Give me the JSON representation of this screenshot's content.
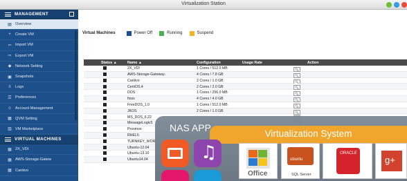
{
  "window": {
    "title": "Virtualization Station",
    "buttons": [
      "#6cbf3a",
      "#2f9ee3",
      "#e84a3c"
    ]
  },
  "sidebar": {
    "management_header": "MANAGEMENT",
    "items": [
      {
        "label": "Overview",
        "icon": "overview-icon",
        "glyph": "▤",
        "active": true
      },
      {
        "label": "Create VM",
        "icon": "plus-icon",
        "glyph": "+"
      },
      {
        "label": "Import VM",
        "icon": "import-icon",
        "glyph": "⇦"
      },
      {
        "label": "Export VM",
        "icon": "export-icon",
        "glyph": "⇨"
      },
      {
        "label": "Network Setting",
        "icon": "network-icon",
        "glyph": "◆"
      },
      {
        "label": "Snapshots",
        "icon": "snapshot-icon",
        "glyph": "▣"
      },
      {
        "label": "Logs",
        "icon": "logs-icon",
        "glyph": "≡"
      },
      {
        "label": "Preferences",
        "icon": "preferences-icon",
        "glyph": "☰"
      },
      {
        "label": "Account Management",
        "icon": "account-icon",
        "glyph": "☺"
      },
      {
        "label": "QVM Setting",
        "icon": "qvm-icon",
        "glyph": "▦"
      },
      {
        "label": "VM Marketplace",
        "icon": "marketplace-icon",
        "glyph": "▥"
      }
    ],
    "vm_header": "VIRTUAL MACHINES",
    "vm_items": [
      {
        "label": "2X_VDI"
      },
      {
        "label": "AWS-Storage-Gatew"
      },
      {
        "label": "Cantivo"
      }
    ]
  },
  "toolbar": {
    "title": "Virtual Machines",
    "legend": [
      {
        "label": "Power Off",
        "color": "#1d4f8a"
      },
      {
        "label": "Running",
        "color": "#4caf50"
      },
      {
        "label": "Suspend",
        "color": "#f0b428"
      }
    ]
  },
  "table": {
    "headers": {
      "status": "Status ▲",
      "name": "Name ▲",
      "configuration": "Configuration",
      "usage": "Usage Rate",
      "action": "Action"
    },
    "action_buttons": [
      "▶",
      "⏸",
      "◯",
      "■",
      "⚙",
      "🔍"
    ],
    "rows": [
      {
        "name": "2X_VDI",
        "config": "1 Cores / 512.0 MB"
      },
      {
        "name": "AWS-Storage-Gateway-",
        "config": "4 Cores / 7.8 GB"
      },
      {
        "name": "Cantivo",
        "config": "2 Cores / 1.0 GB"
      },
      {
        "name": "CentOS.4",
        "config": "2 Cores / 2.0 GB"
      },
      {
        "name": "DOS",
        "config": "1 Cores / 256.0 MB"
      },
      {
        "name": "fioss",
        "config": "4 Cores / 4.0 GB"
      },
      {
        "name": "FreeDOS_1.0",
        "config": "1 Cores / 512.0 MB"
      },
      {
        "name": "JKOS",
        "config": "2 Cores / 1.0 GB"
      },
      {
        "name": "MS_DOS_6.22",
        "config": ""
      },
      {
        "name": "MessageLogic5",
        "config": ""
      },
      {
        "name": "Proxmox",
        "config": ""
      },
      {
        "name": "RHEL6",
        "config": ""
      },
      {
        "name": "TURNKEY_WOR",
        "config": ""
      },
      {
        "name": "Ubuntu-12.04",
        "config": ""
      },
      {
        "name": "Ubuntu-13.10",
        "config": ""
      },
      {
        "name": "Ubuntu14.04",
        "config": ""
      }
    ]
  },
  "promo": {
    "nas_title": "NAS APP",
    "virt_title": "Virtualization System",
    "office_label": "Office",
    "ubuntu_label": "ubuntu",
    "sqlserver_label": "SQL Server",
    "oracle_label": "ORACLE",
    "gplus_label": "g+"
  }
}
